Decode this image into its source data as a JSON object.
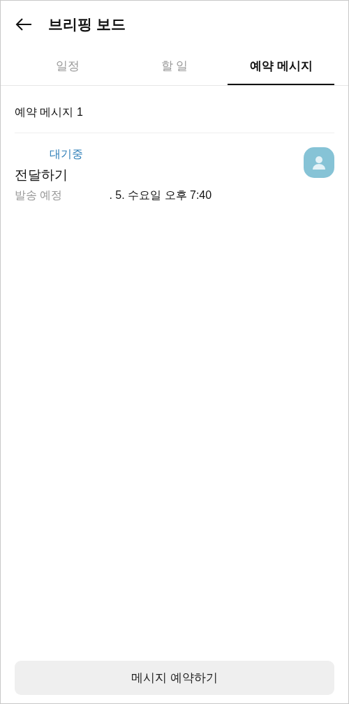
{
  "header": {
    "title": "브리핑 보드"
  },
  "tabs": [
    {
      "label": "일정",
      "selected": false
    },
    {
      "label": "할 일",
      "selected": false
    },
    {
      "label": "예약 메시지",
      "selected": true
    }
  ],
  "section": {
    "title": "예약 메시지 1"
  },
  "messages": [
    {
      "status": "대기중",
      "title": "전달하기",
      "schedule_label": "발송 예정",
      "schedule_time": ". 5. 수요일 오후 7:40"
    }
  ],
  "primary_button": {
    "label": "메시지 예약하기"
  }
}
